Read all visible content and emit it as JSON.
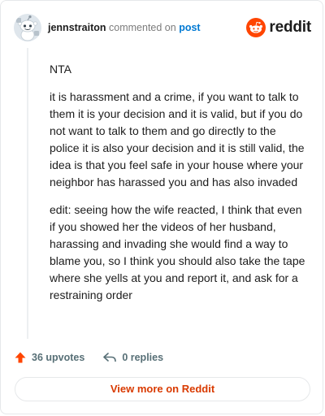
{
  "header": {
    "username": "jennstraiton",
    "action_text": "commented on",
    "post_link": "post",
    "brand_name": "reddit",
    "brand_color": "#ff4500",
    "avatar_icon": "snoo-avatar-icon"
  },
  "comment": {
    "paragraphs": [
      "NTA",
      "it is harassment and a crime, if you want to talk to them it is your decision and it is valid, but if you do not want to talk to them and go directly to the police it is also your decision and it is still valid, the idea is that you feel safe in your house where your neighbor has harassed you and has also invaded",
      "edit: seeing how the wife reacted, I think that even if you showed her the videos of her husband, harassing and invading she would find a way to blame you, so I think you should also take the tape where she yells at you and report it, and ask for a restraining order"
    ]
  },
  "footer": {
    "upvotes": "36 upvotes",
    "replies": "0 replies",
    "upvote_icon": "upvote-arrow-icon",
    "reply_icon": "reply-arrow-icon"
  },
  "view_more": {
    "label": "View more on Reddit",
    "color": "#d93a00"
  }
}
